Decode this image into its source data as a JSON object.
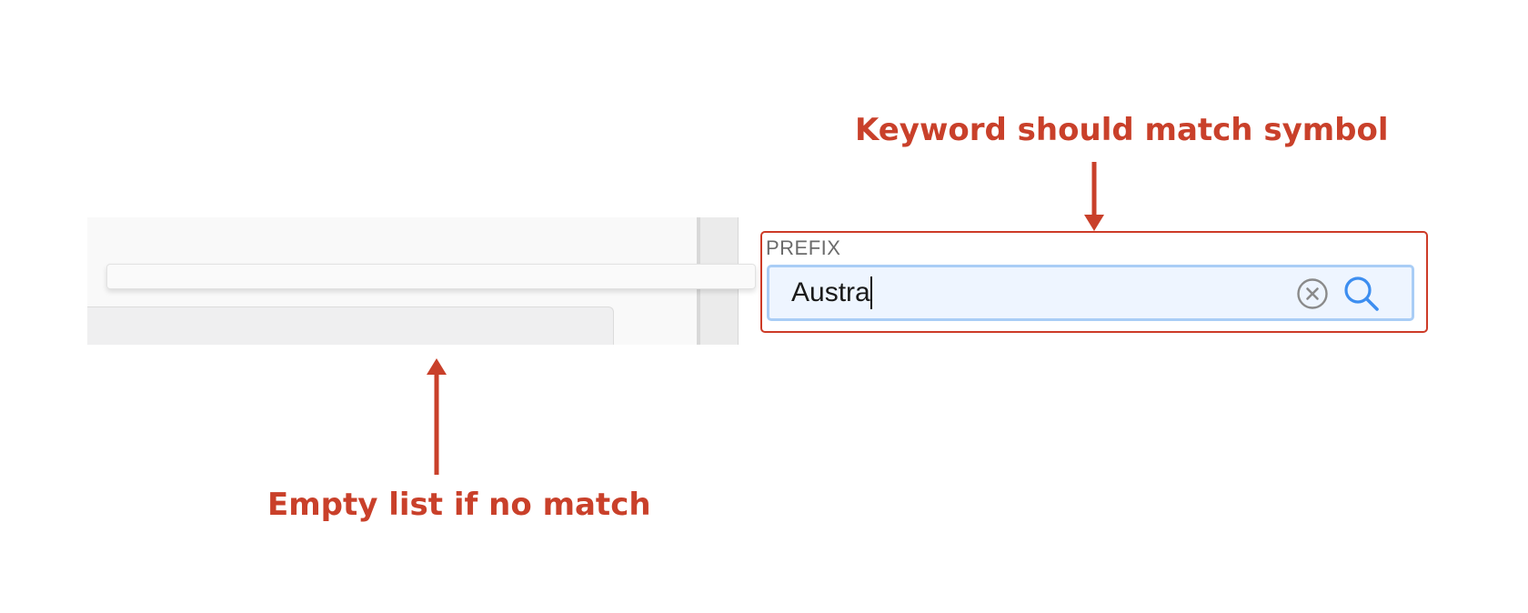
{
  "search": {
    "label": "PREFIX",
    "value": "Austra",
    "clear_icon": "clear-circle-x-icon",
    "search_icon": "magnifier-icon"
  },
  "results": {
    "items": []
  },
  "annotations": {
    "top_text": "Keyword should match symbol",
    "bottom_text": "Empty list if no match",
    "color": "#c9402a"
  },
  "colors": {
    "input_background": "#eef5ff",
    "input_focus_border": "#a9cdf6",
    "search_icon": "#3d8ef0",
    "highlight_border": "#cd3b27"
  }
}
